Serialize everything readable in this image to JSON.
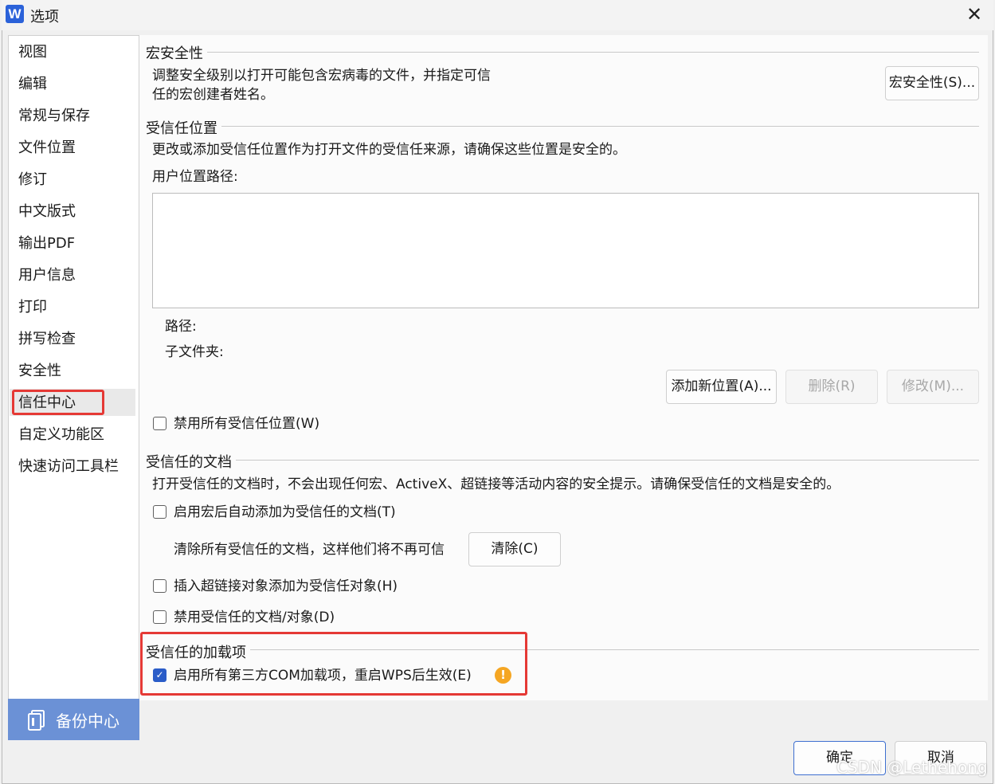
{
  "window": {
    "title": "选项",
    "app_logo": "W",
    "close_icon": "✕"
  },
  "sidebar": {
    "items": [
      {
        "label": "视图"
      },
      {
        "label": "编辑"
      },
      {
        "label": "常规与保存"
      },
      {
        "label": "文件位置"
      },
      {
        "label": "修订"
      },
      {
        "label": "中文版式"
      },
      {
        "label": "输出PDF"
      },
      {
        "label": "用户信息"
      },
      {
        "label": "打印"
      },
      {
        "label": "拼写检查"
      },
      {
        "label": "安全性"
      },
      {
        "label": "信任中心",
        "selected": true
      },
      {
        "label": "自定义功能区"
      },
      {
        "label": "快速访问工具栏"
      }
    ],
    "backup_label": "备份中心",
    "backup_icon": "backup-document-icon"
  },
  "macro": {
    "title": "宏安全性",
    "desc_line1": "调整安全级别以打开可能包含宏病毒的文件，并指定可信",
    "desc_line2": "任的宏创建者姓名。",
    "button_label": "宏安全性(S)..."
  },
  "trusted_locations": {
    "title": "受信任位置",
    "desc": "更改或添加受信任位置作为打开文件的受信任来源，请确保这些位置是安全的。",
    "user_path_label": "用户位置路径:",
    "path_label": "路径:",
    "subfolder_label": "子文件夹:",
    "add_button": "添加新位置(A)...",
    "delete_button": "删除(R)",
    "modify_button": "修改(M)...",
    "disable_all_label": "禁用所有受信任位置(W)",
    "disable_all_checked": false
  },
  "trusted_docs": {
    "title": "受信任的文档",
    "desc": "打开受信任的文档时，不会出现任何宏、ActiveX、超链接等活动内容的安全提示。请确保受信任的文档是安全的。",
    "auto_add_label": "启用宏后自动添加为受信任的文档(T)",
    "auto_add_checked": false,
    "clear_desc": "清除所有受信任的文档，这样他们将不再可信",
    "clear_button": "清除(C)",
    "hyperlink_label": "插入超链接对象添加为受信任对象(H)",
    "hyperlink_checked": false,
    "disable_docs_label": "禁用受信任的文档/对象(D)",
    "disable_docs_checked": false
  },
  "addins": {
    "title": "受信任的加载项",
    "enable_com_label": "启用所有第三方COM加载项，重启WPS后生效(E)",
    "enable_com_checked": true,
    "warning_icon": "!"
  },
  "footer": {
    "ok": "确定",
    "cancel": "取消"
  },
  "watermark": "CSDN @Lethehong",
  "colors": {
    "accent": "#2a5cc8",
    "highlight_box": "#e53935",
    "backup_bg": "#6b91d6",
    "warning": "#f5a623"
  }
}
